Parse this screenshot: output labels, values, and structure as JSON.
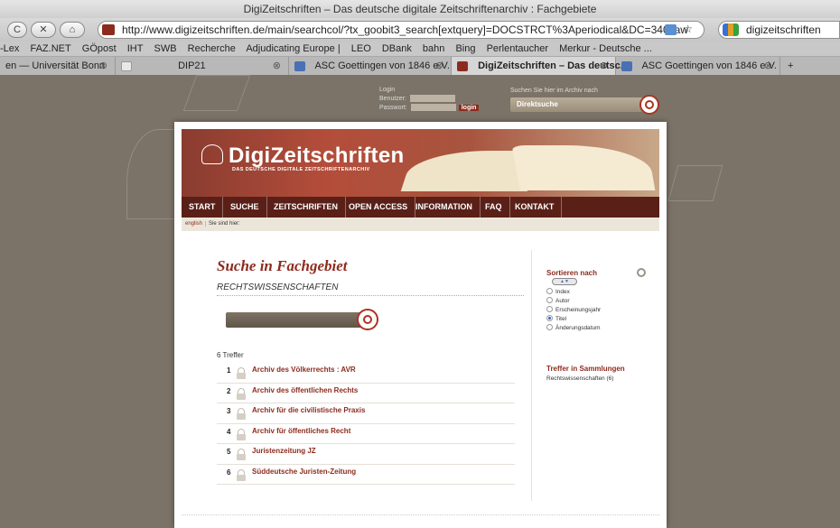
{
  "browser": {
    "window_title": "DigiZeitschriften – Das deutsche digitale Zeitschriftenarchiv : Fachgebiete",
    "back_label": "C",
    "stop_label": "✕",
    "home_label": "⌂",
    "url": "http://www.digizeitschriften.de/main/searchcol/?tx_goobit3_search[extquery]=DOCSTRCT%3Aperiodical&DC=340.law",
    "search_value": "digizeitschriften",
    "bookmarks": [
      "-Lex",
      "FAZ.NET",
      "GÖpost",
      "IHT",
      "SWB",
      "Recherche",
      "Adjudicating Europe |",
      "LEO",
      "DBank",
      "bahn",
      "Bing",
      "Perlentaucher",
      "Merkur - Deutsche ..."
    ],
    "tabs": [
      {
        "label": "en — Universität Bonn"
      },
      {
        "label": "DIP21"
      },
      {
        "label": "ASC Goettingen von 1846 e.V."
      },
      {
        "label": "DigiZeitschriften – Das deutsc..."
      },
      {
        "label": "ASC Goettingen von 1846 e.V."
      }
    ],
    "new_tab_label": "+"
  },
  "header": {
    "login_label": "Login",
    "user_label": "Benutzer:",
    "password_label": "Passwort:",
    "login_button": "login",
    "search_hint": "Suchen Sie hier im Archiv nach",
    "direct_search": "Direktsuche"
  },
  "banner": {
    "logo": "DigiZeitschriften",
    "logo_sub": "DAS DEUTSCHE DIGITALE ZEITSCHRIFTENARCHIV"
  },
  "nav": [
    "START",
    "SUCHE",
    "ZEITSCHRIFTEN",
    "OPEN ACCESS",
    "INFORMATION",
    "FAQ",
    "KONTAKT"
  ],
  "breadcrumb": {
    "lang": "english",
    "here": "Sie sind hier:"
  },
  "main": {
    "title": "Suche in Fachgebiet",
    "subject": "RECHTSWISSENSCHAFTEN",
    "hits": "6 Treffer",
    "results": [
      {
        "num": "1",
        "title": "Archiv des Völkerrechts : AVR"
      },
      {
        "num": "2",
        "title": "Archiv des öffentlichen Rechts"
      },
      {
        "num": "3",
        "title": "Archiv für die civilistische Praxis"
      },
      {
        "num": "4",
        "title": "Archiv für öffentliches Recht"
      },
      {
        "num": "5",
        "title": "Juristenzeitung JZ"
      },
      {
        "num": "6",
        "title": "Süddeutsche Juristen-Zeitung"
      }
    ]
  },
  "sidebar": {
    "sort_label": "Sortieren nach",
    "sort_options": [
      {
        "label": "Index",
        "selected": false
      },
      {
        "label": "Autor",
        "selected": false
      },
      {
        "label": "Erscheinungsjahr",
        "selected": false
      },
      {
        "label": "Titel",
        "selected": true
      },
      {
        "label": "Änderungsdatum",
        "selected": false
      }
    ],
    "collections_label": "Treffer in Sammlungen",
    "collections_value": "Rechtswissenschaften (6)"
  }
}
